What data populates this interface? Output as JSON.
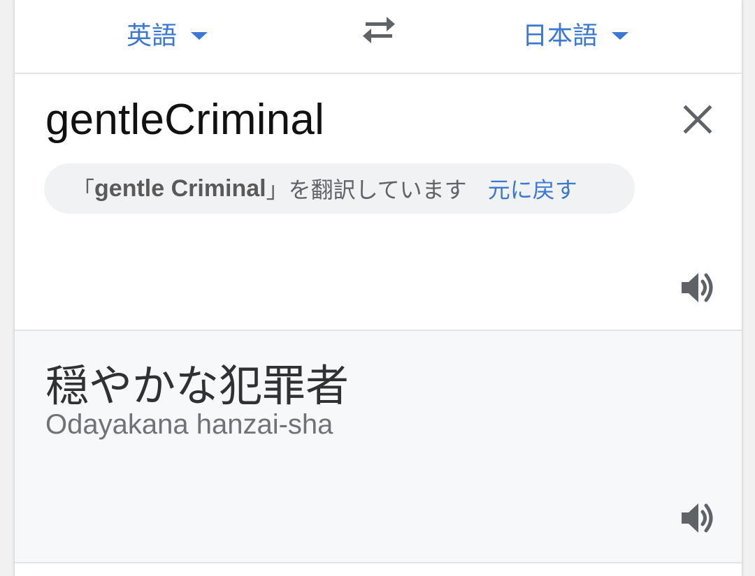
{
  "language_bar": {
    "source_language": "英語",
    "target_language": "日本語",
    "swap_icon": "swap-arrows-icon"
  },
  "input": {
    "text": "gentleCriminal",
    "clear_icon": "close-icon",
    "suggestion": {
      "bracket_open": "「",
      "query": "gentle Criminal",
      "bracket_close": "」",
      "message": "を翻訳しています",
      "revert_label": "元に戻す"
    },
    "speaker_icon": "speaker-icon"
  },
  "output": {
    "translation": "穏やかな犯罪者",
    "romanization": "Odayakana hanzai-sha",
    "speaker_icon": "speaker-icon"
  },
  "colors": {
    "accent": "#3b78d1",
    "output_background": "#f7f8fa",
    "icon_gray": "#5f6368"
  }
}
